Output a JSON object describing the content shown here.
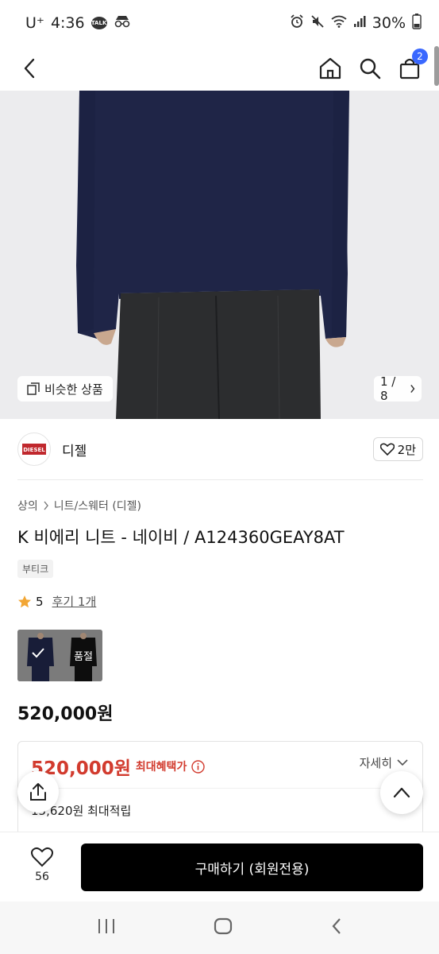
{
  "status_bar": {
    "carrier": "U⁺",
    "time": "4:36",
    "battery": "30%"
  },
  "header": {
    "cart_count": "2"
  },
  "hero": {
    "similar_label": "비슷한 상품",
    "page_indicator": "1 / 8"
  },
  "brand": {
    "logo_text": "DIESEL",
    "name": "디젤",
    "like_count": "2만"
  },
  "breadcrumb": {
    "category": "상의",
    "subcategory": "니트/스웨터 (디젤)"
  },
  "product": {
    "title": "K 비에리 니트 - 네이비 / A124360GEAY8AT",
    "tag": "부티크",
    "rating": "5",
    "review_link": "후기 1개",
    "option_soldout": "품절",
    "price": "520,000원"
  },
  "benefit": {
    "amount": "520,000원",
    "label": "최대혜택가",
    "detail_toggle": "자세히",
    "points": "15,620원 최대적립"
  },
  "bottom_bar": {
    "wish_count": "56",
    "buy_label": "구매하기 (회원전용)"
  },
  "colors": {
    "accent_price": "#d23b2e",
    "cart_badge": "#3a68ff",
    "buy_button": "#000000",
    "sweater": "#1f2547"
  }
}
